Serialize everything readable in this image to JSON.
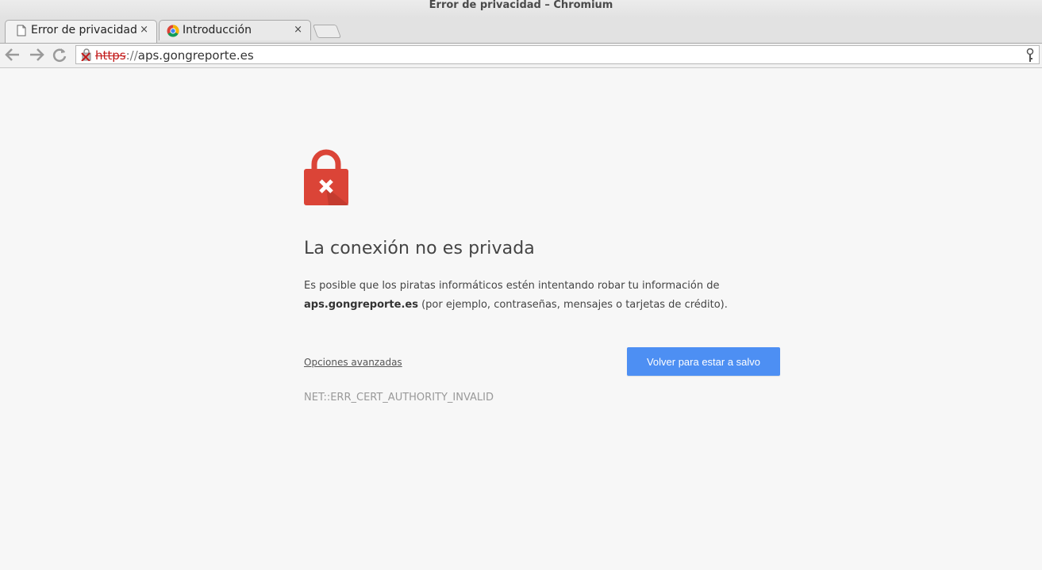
{
  "window": {
    "title": "Error de privacidad – Chromium"
  },
  "tabs": [
    {
      "label": "Error de privacidad",
      "close": "×",
      "icon": "page-icon"
    },
    {
      "label": "Introducción",
      "close": "×",
      "icon": "chromium-icon"
    }
  ],
  "omnibox": {
    "scheme": "https",
    "separator": "://",
    "host": "aps.gongreporte.es"
  },
  "interstitial": {
    "icon": "lock-error-icon",
    "heading": "La conexión no es privada",
    "message_before": "Es posible que los piratas informáticos estén intentando robar tu información de ",
    "domain": "aps.gongreporte.es",
    "message_after": " (por ejemplo, contraseñas, mensajes o tarjetas de crédito).",
    "advanced_link": "Opciones avanzadas",
    "primary_button": "Volver para estar a salvo",
    "error_code": "NET::ERR_CERT_AUTHORITY_INVALID"
  },
  "colors": {
    "accent": "#4d8ff3",
    "lock_red": "#db4437",
    "scheme_red": "#c21a1a"
  }
}
